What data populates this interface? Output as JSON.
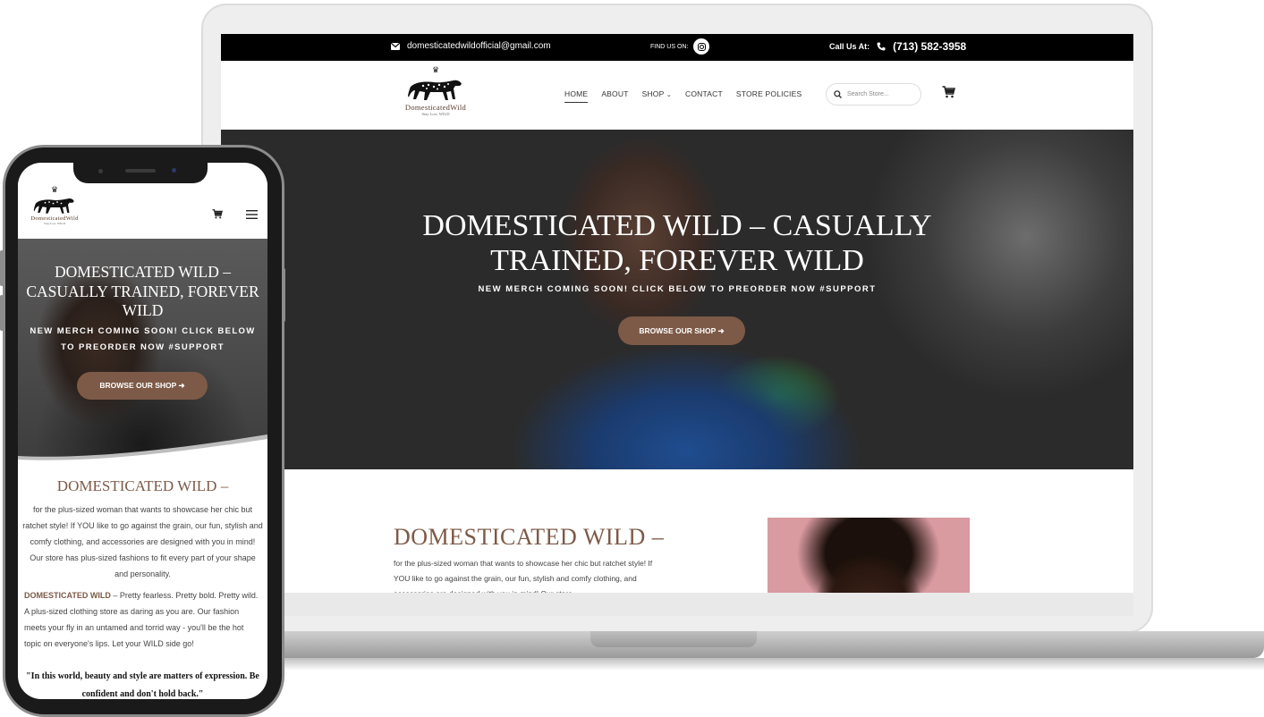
{
  "colors": {
    "accent": "#7d5a47",
    "topbar": "#000000",
    "text": "#444444"
  },
  "topbar": {
    "email_icon": "envelope-icon",
    "email": "domesticatedwildofficial@gmail.com",
    "find_us": "FIND US ON:",
    "social_icon": "instagram-icon",
    "call_label": "Call Us At:",
    "phone_icon": "phone-icon",
    "phone": "(713) 582-3958"
  },
  "brand": {
    "logo_icon": "leopard-icon",
    "name": "DomesticatedWild",
    "tagline": "Stay Low. WILD"
  },
  "nav": {
    "items": [
      {
        "label": "HOME"
      },
      {
        "label": "ABOUT"
      },
      {
        "label": "SHOP"
      },
      {
        "label": "CONTACT"
      },
      {
        "label": "STORE POLICIES"
      }
    ],
    "search_placeholder": "Search Store...",
    "cart_icon": "cart-icon"
  },
  "hero": {
    "title_line1": "DOMESTICATED WILD – CASUALLY",
    "title_line2": "TRAINED, FOREVER WILD",
    "subtitle": "NEW MERCH COMING SOON! CLICK BELOW TO PREORDER NOW #SUPPORT",
    "button": "BROWSE OUR SHOP ➜"
  },
  "content": {
    "title": "DOMESTICATED WILD –",
    "paragraph": "for the plus-sized woman that wants to showcase her chic but ratchet style! If YOU like to go against the grain, our fun, stylish and comfy clothing, and accessories are designed with you in mind! Our store",
    "photo_icon": "model-photo"
  },
  "mobile": {
    "hero_title": "DOMESTICATED WILD – CASUALLY TRAINED, FOREVER WILD",
    "hero_subtitle": "NEW MERCH COMING SOON! CLICK BELOW TO PREORDER NOW #SUPPORT",
    "hero_button": "BROWSE OUR SHOP ➜",
    "section_title": "DOMESTICATED WILD –",
    "paragraph1": "for the plus-sized woman that wants to showcase her chic but ratchet style! If YOU like to go against the grain, our fun, stylish and comfy clothing, and accessories are designed with you in mind! Our store has plus-sized fashions to fit every part of your shape and personality.",
    "paragraph2_strong": "DOMESTICATED WILD",
    "paragraph2": " – Pretty fearless. Pretty bold. Pretty wild. A plus-sized clothing store as daring as you are. Our fashion meets your fly in an untamed and torrid way - you'll be the hot topic on everyone's lips. Let your WILD side go!",
    "quote": "\"In this world, beauty and style are matters of expression. Be confident and don't hold back.\""
  }
}
